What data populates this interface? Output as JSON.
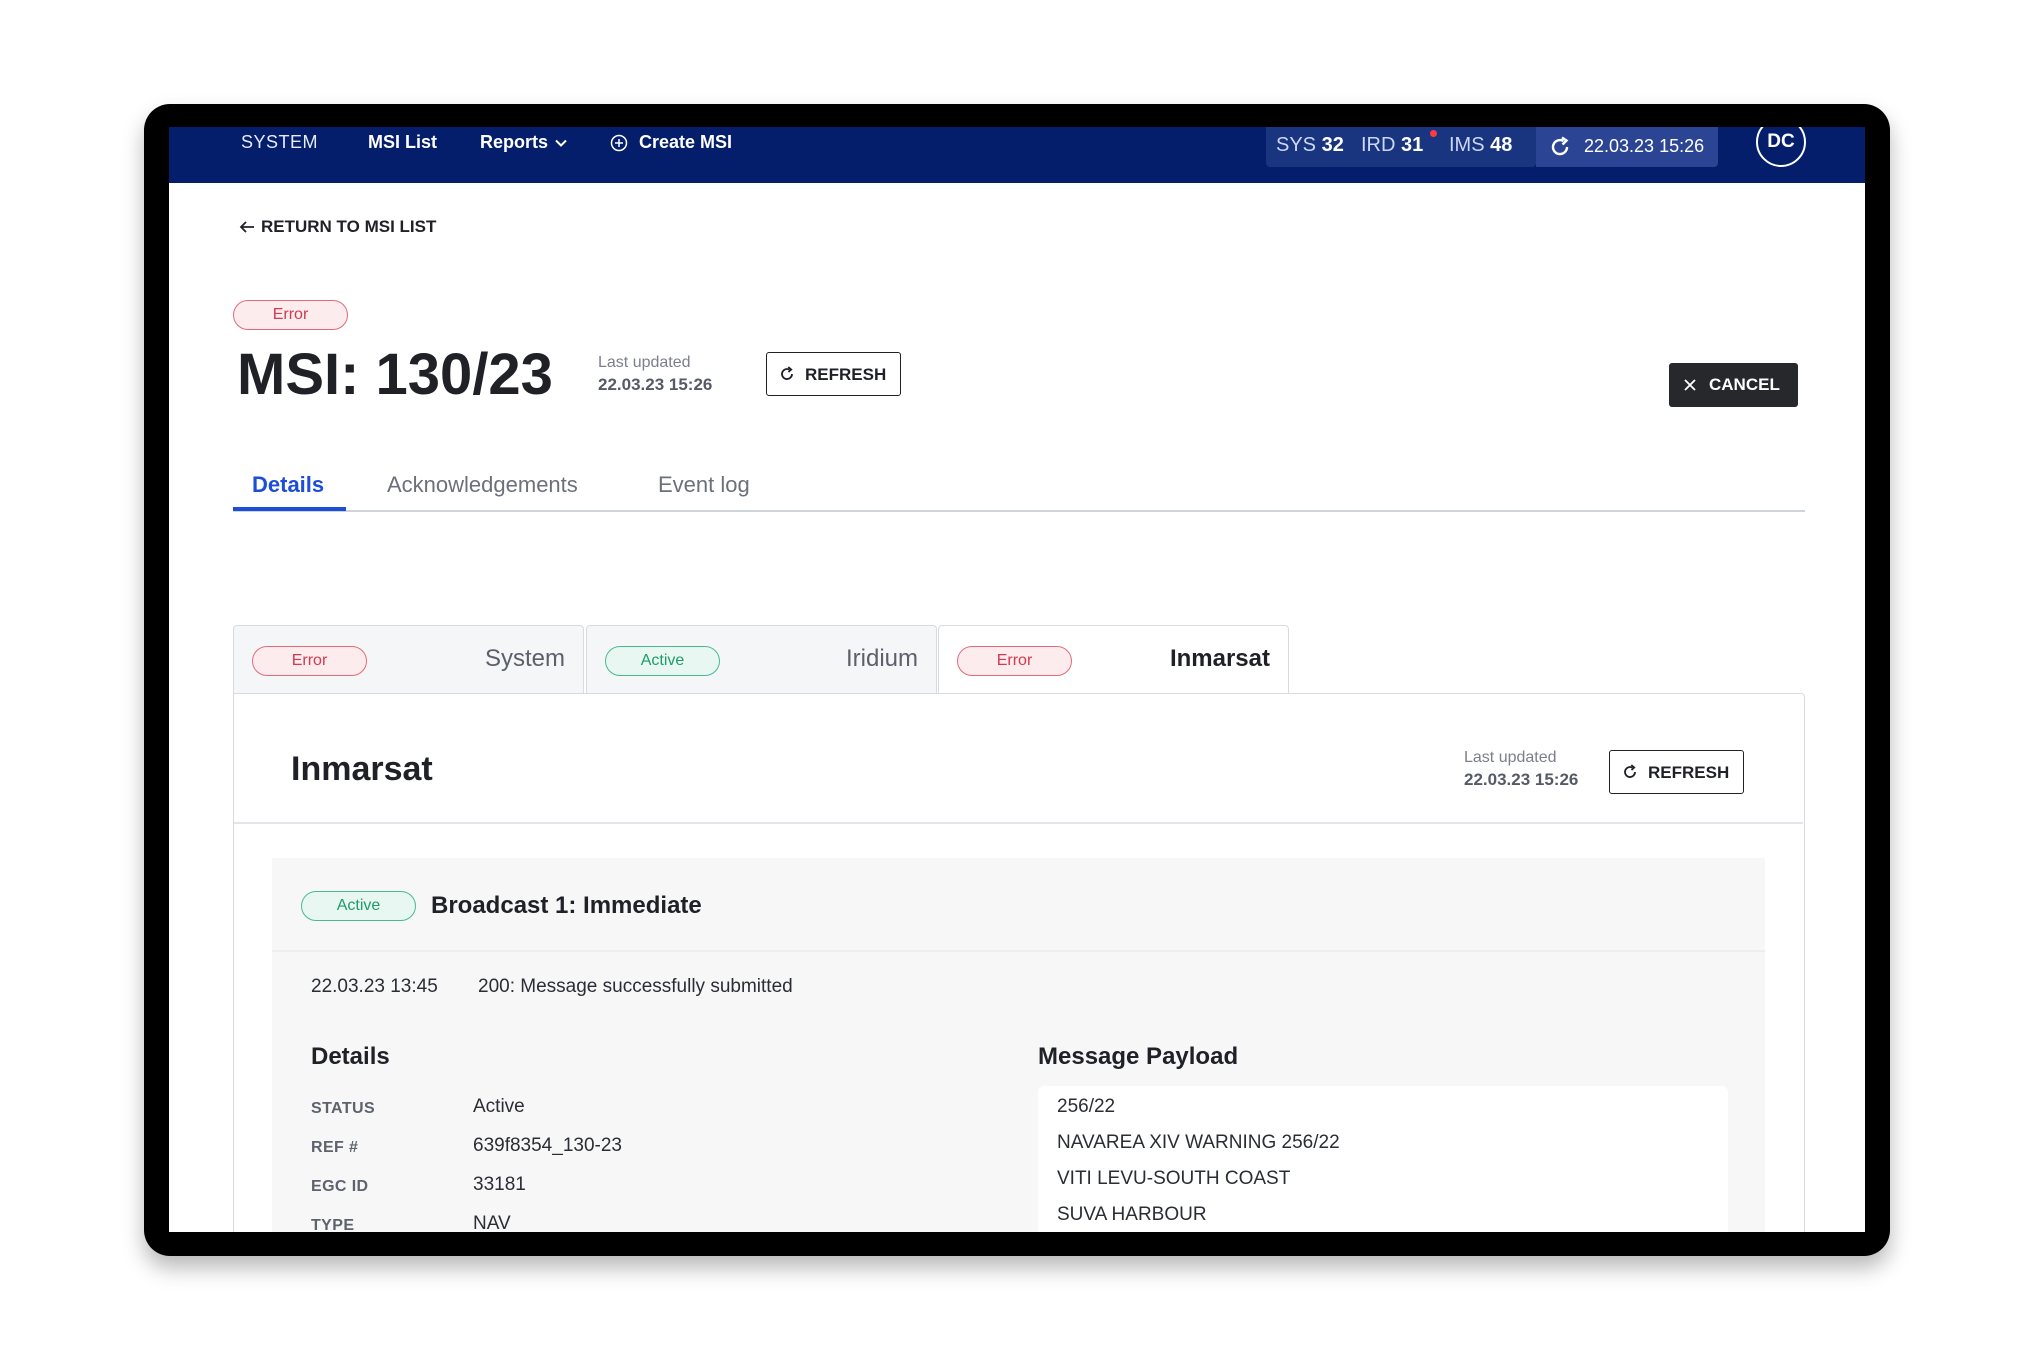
{
  "nav": {
    "system": "SYSTEM",
    "msi_list": "MSI List",
    "reports": "Reports",
    "create_msi": "Create MSI",
    "counters": {
      "sys_label": "SYS",
      "sys_value": "32",
      "ird_label": "IRD",
      "ird_value": "31",
      "ims_label": "IMS",
      "ims_value": "48"
    },
    "refresh_time": "22.03.23 15:26",
    "avatar": "DC"
  },
  "return_link": "RETURN TO MSI LIST",
  "header": {
    "status_badge": "Error",
    "title": "MSI: 130/23",
    "last_updated_label": "Last updated",
    "last_updated_value": "22.03.23 15:26",
    "refresh_label": "REFRESH",
    "cancel_label": "CANCEL"
  },
  "tabs": [
    {
      "label": "Details",
      "active": true
    },
    {
      "label": "Acknowledgements",
      "active": false
    },
    {
      "label": "Event log",
      "active": false
    }
  ],
  "provider_tabs": [
    {
      "name": "System",
      "status": "Error",
      "active": false
    },
    {
      "name": "Iridium",
      "status": "Active",
      "active": false
    },
    {
      "name": "Inmarsat",
      "status": "Error",
      "active": true
    }
  ],
  "panel": {
    "title": "Inmarsat",
    "last_updated_label": "Last updated",
    "last_updated_value": "22.03.23 15:26",
    "refresh_label": "REFRESH",
    "broadcast": {
      "status": "Active",
      "title": "Broadcast 1: Immediate",
      "date": "22.03.23 13:45",
      "message": "200: Message successfully submitted",
      "details_title": "Details",
      "details": [
        {
          "key": "STATUS",
          "value": "Active"
        },
        {
          "key": "REF #",
          "value": "639f8354_130-23"
        },
        {
          "key": "EGC ID",
          "value": "33181"
        },
        {
          "key": "TYPE",
          "value": "NAV"
        }
      ],
      "payload_title": "Message Payload",
      "payload": [
        "256/22",
        "NAVAREA XIV WARNING 256/22",
        "VITI LEVU-SOUTH COAST",
        "SUVA HARBOUR"
      ]
    }
  },
  "colors": {
    "nav_bg": "#041e6b",
    "accent": "#1d4ed8",
    "error": "#d23a4f",
    "active": "#1f9b6c"
  }
}
